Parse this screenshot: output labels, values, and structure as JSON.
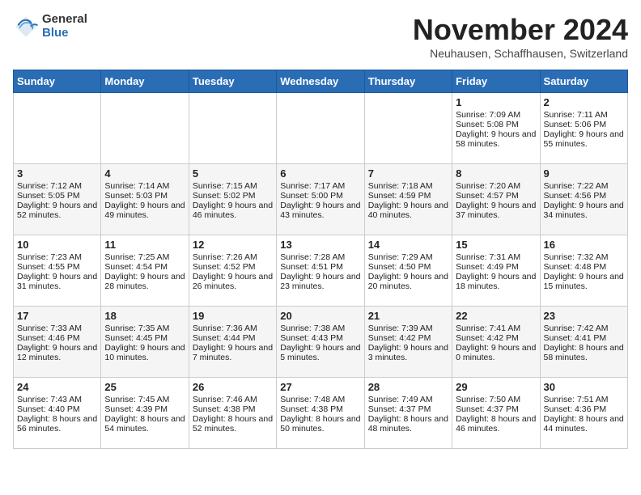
{
  "header": {
    "logo_general": "General",
    "logo_blue": "Blue",
    "month_title": "November 2024",
    "location": "Neuhausen, Schaffhausen, Switzerland"
  },
  "days_of_week": [
    "Sunday",
    "Monday",
    "Tuesday",
    "Wednesday",
    "Thursday",
    "Friday",
    "Saturday"
  ],
  "weeks": [
    [
      {
        "day": "",
        "sunrise": "",
        "sunset": "",
        "daylight": ""
      },
      {
        "day": "",
        "sunrise": "",
        "sunset": "",
        "daylight": ""
      },
      {
        "day": "",
        "sunrise": "",
        "sunset": "",
        "daylight": ""
      },
      {
        "day": "",
        "sunrise": "",
        "sunset": "",
        "daylight": ""
      },
      {
        "day": "",
        "sunrise": "",
        "sunset": "",
        "daylight": ""
      },
      {
        "day": "1",
        "sunrise": "Sunrise: 7:09 AM",
        "sunset": "Sunset: 5:08 PM",
        "daylight": "Daylight: 9 hours and 58 minutes."
      },
      {
        "day": "2",
        "sunrise": "Sunrise: 7:11 AM",
        "sunset": "Sunset: 5:06 PM",
        "daylight": "Daylight: 9 hours and 55 minutes."
      }
    ],
    [
      {
        "day": "3",
        "sunrise": "Sunrise: 7:12 AM",
        "sunset": "Sunset: 5:05 PM",
        "daylight": "Daylight: 9 hours and 52 minutes."
      },
      {
        "day": "4",
        "sunrise": "Sunrise: 7:14 AM",
        "sunset": "Sunset: 5:03 PM",
        "daylight": "Daylight: 9 hours and 49 minutes."
      },
      {
        "day": "5",
        "sunrise": "Sunrise: 7:15 AM",
        "sunset": "Sunset: 5:02 PM",
        "daylight": "Daylight: 9 hours and 46 minutes."
      },
      {
        "day": "6",
        "sunrise": "Sunrise: 7:17 AM",
        "sunset": "Sunset: 5:00 PM",
        "daylight": "Daylight: 9 hours and 43 minutes."
      },
      {
        "day": "7",
        "sunrise": "Sunrise: 7:18 AM",
        "sunset": "Sunset: 4:59 PM",
        "daylight": "Daylight: 9 hours and 40 minutes."
      },
      {
        "day": "8",
        "sunrise": "Sunrise: 7:20 AM",
        "sunset": "Sunset: 4:57 PM",
        "daylight": "Daylight: 9 hours and 37 minutes."
      },
      {
        "day": "9",
        "sunrise": "Sunrise: 7:22 AM",
        "sunset": "Sunset: 4:56 PM",
        "daylight": "Daylight: 9 hours and 34 minutes."
      }
    ],
    [
      {
        "day": "10",
        "sunrise": "Sunrise: 7:23 AM",
        "sunset": "Sunset: 4:55 PM",
        "daylight": "Daylight: 9 hours and 31 minutes."
      },
      {
        "day": "11",
        "sunrise": "Sunrise: 7:25 AM",
        "sunset": "Sunset: 4:54 PM",
        "daylight": "Daylight: 9 hours and 28 minutes."
      },
      {
        "day": "12",
        "sunrise": "Sunrise: 7:26 AM",
        "sunset": "Sunset: 4:52 PM",
        "daylight": "Daylight: 9 hours and 26 minutes."
      },
      {
        "day": "13",
        "sunrise": "Sunrise: 7:28 AM",
        "sunset": "Sunset: 4:51 PM",
        "daylight": "Daylight: 9 hours and 23 minutes."
      },
      {
        "day": "14",
        "sunrise": "Sunrise: 7:29 AM",
        "sunset": "Sunset: 4:50 PM",
        "daylight": "Daylight: 9 hours and 20 minutes."
      },
      {
        "day": "15",
        "sunrise": "Sunrise: 7:31 AM",
        "sunset": "Sunset: 4:49 PM",
        "daylight": "Daylight: 9 hours and 18 minutes."
      },
      {
        "day": "16",
        "sunrise": "Sunrise: 7:32 AM",
        "sunset": "Sunset: 4:48 PM",
        "daylight": "Daylight: 9 hours and 15 minutes."
      }
    ],
    [
      {
        "day": "17",
        "sunrise": "Sunrise: 7:33 AM",
        "sunset": "Sunset: 4:46 PM",
        "daylight": "Daylight: 9 hours and 12 minutes."
      },
      {
        "day": "18",
        "sunrise": "Sunrise: 7:35 AM",
        "sunset": "Sunset: 4:45 PM",
        "daylight": "Daylight: 9 hours and 10 minutes."
      },
      {
        "day": "19",
        "sunrise": "Sunrise: 7:36 AM",
        "sunset": "Sunset: 4:44 PM",
        "daylight": "Daylight: 9 hours and 7 minutes."
      },
      {
        "day": "20",
        "sunrise": "Sunrise: 7:38 AM",
        "sunset": "Sunset: 4:43 PM",
        "daylight": "Daylight: 9 hours and 5 minutes."
      },
      {
        "day": "21",
        "sunrise": "Sunrise: 7:39 AM",
        "sunset": "Sunset: 4:42 PM",
        "daylight": "Daylight: 9 hours and 3 minutes."
      },
      {
        "day": "22",
        "sunrise": "Sunrise: 7:41 AM",
        "sunset": "Sunset: 4:42 PM",
        "daylight": "Daylight: 9 hours and 0 minutes."
      },
      {
        "day": "23",
        "sunrise": "Sunrise: 7:42 AM",
        "sunset": "Sunset: 4:41 PM",
        "daylight": "Daylight: 8 hours and 58 minutes."
      }
    ],
    [
      {
        "day": "24",
        "sunrise": "Sunrise: 7:43 AM",
        "sunset": "Sunset: 4:40 PM",
        "daylight": "Daylight: 8 hours and 56 minutes."
      },
      {
        "day": "25",
        "sunrise": "Sunrise: 7:45 AM",
        "sunset": "Sunset: 4:39 PM",
        "daylight": "Daylight: 8 hours and 54 minutes."
      },
      {
        "day": "26",
        "sunrise": "Sunrise: 7:46 AM",
        "sunset": "Sunset: 4:38 PM",
        "daylight": "Daylight: 8 hours and 52 minutes."
      },
      {
        "day": "27",
        "sunrise": "Sunrise: 7:48 AM",
        "sunset": "Sunset: 4:38 PM",
        "daylight": "Daylight: 8 hours and 50 minutes."
      },
      {
        "day": "28",
        "sunrise": "Sunrise: 7:49 AM",
        "sunset": "Sunset: 4:37 PM",
        "daylight": "Daylight: 8 hours and 48 minutes."
      },
      {
        "day": "29",
        "sunrise": "Sunrise: 7:50 AM",
        "sunset": "Sunset: 4:37 PM",
        "daylight": "Daylight: 8 hours and 46 minutes."
      },
      {
        "day": "30",
        "sunrise": "Sunrise: 7:51 AM",
        "sunset": "Sunset: 4:36 PM",
        "daylight": "Daylight: 8 hours and 44 minutes."
      }
    ]
  ]
}
